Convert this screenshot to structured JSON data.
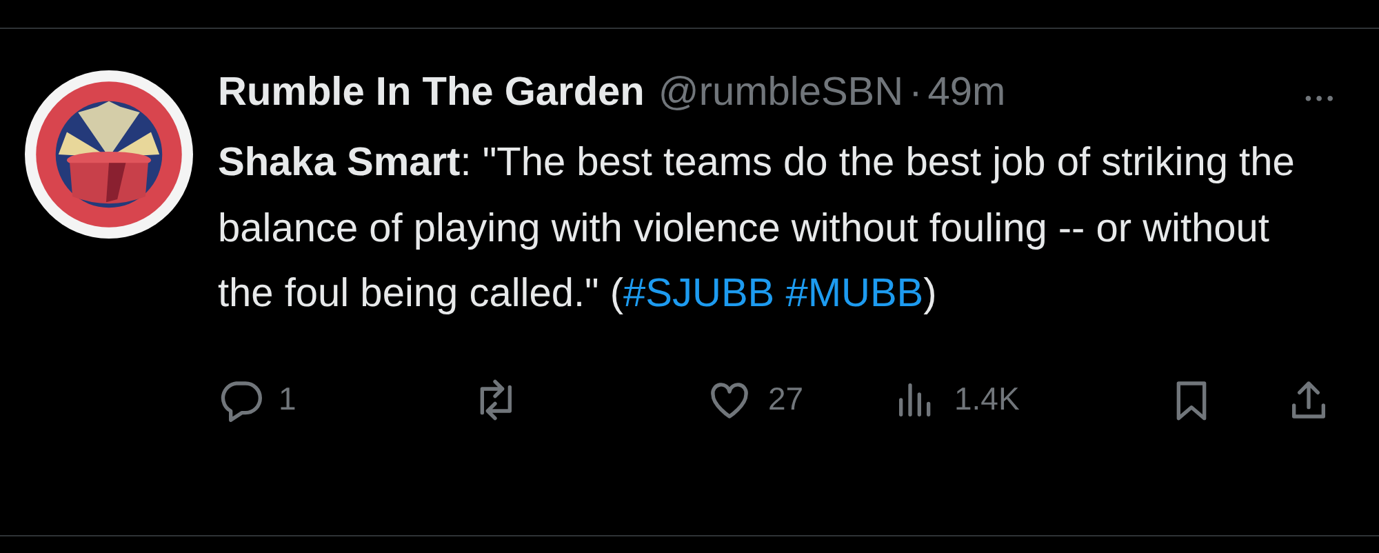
{
  "tweet": {
    "author": {
      "name": "Rumble In The Garden",
      "handle": "@rumbleSBN",
      "separator": "·",
      "time": "49m",
      "more": "•••"
    },
    "text": {
      "lead": "**Shaka Smart**: \"The best teams do the best job of striking the balance of playing with violence without fouling -- or without the foul being called.\" (",
      "hashtags": [
        "#SJUBB",
        "#MUBB"
      ],
      "tail": ")"
    },
    "actions": [
      {
        "kind": "reply",
        "count": "1"
      },
      {
        "kind": "repost"
      },
      {
        "kind": "like",
        "count": "27"
      },
      {
        "kind": "views",
        "count": "1.4K"
      },
      {
        "kind": "bookmark"
      },
      {
        "kind": "share"
      }
    ]
  }
}
